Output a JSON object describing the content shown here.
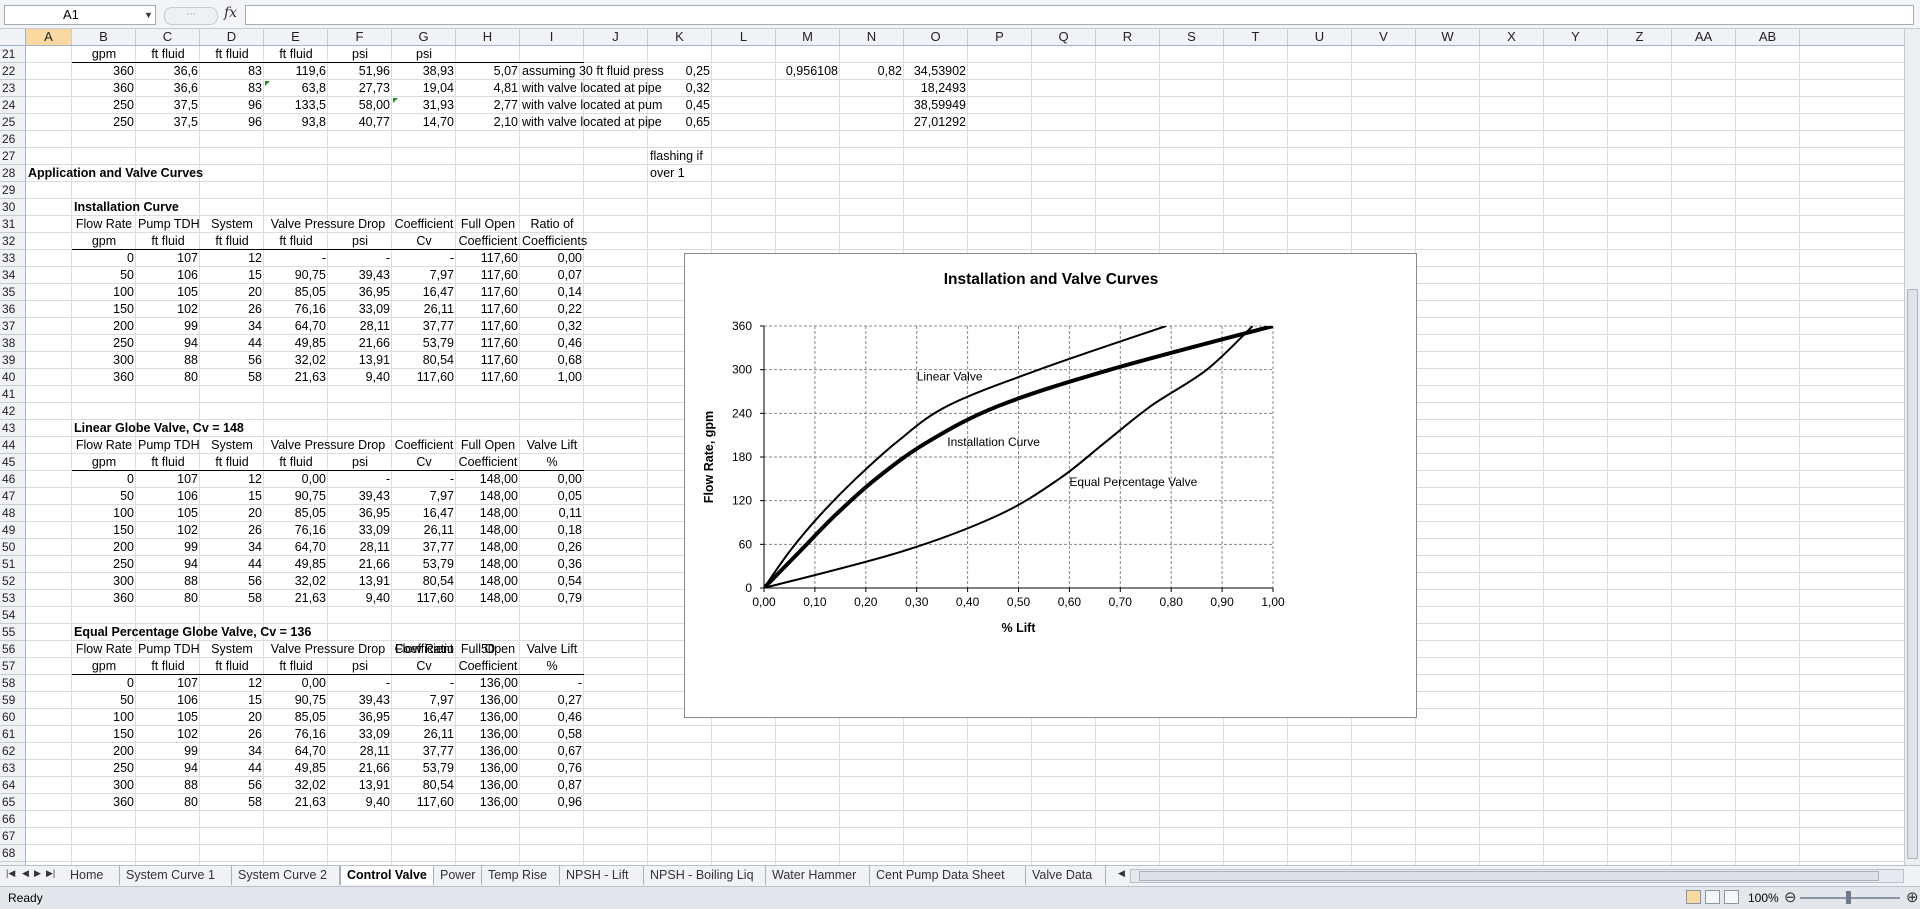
{
  "formula_bar": {
    "name_box": "A1",
    "formula": "",
    "fx": "fx"
  },
  "columns": [
    "A",
    "B",
    "C",
    "D",
    "E",
    "F",
    "G",
    "H",
    "I",
    "J",
    "K",
    "L",
    "M",
    "N",
    "O",
    "P",
    "Q",
    "R",
    "S",
    "T",
    "U",
    "V",
    "W",
    "X",
    "Y",
    "Z",
    "AA",
    "AB"
  ],
  "rows": [
    "21",
    "22",
    "23",
    "24",
    "25",
    "26",
    "27",
    "28",
    "29",
    "30",
    "31",
    "32",
    "33",
    "34",
    "35",
    "36",
    "37",
    "38",
    "39",
    "40",
    "41",
    "42",
    "43",
    "44",
    "45",
    "46",
    "47",
    "48",
    "49",
    "50",
    "51",
    "52",
    "53",
    "54",
    "55",
    "56",
    "57",
    "58",
    "59",
    "60",
    "61",
    "62",
    "63",
    "64",
    "65",
    "66",
    "67",
    "68"
  ],
  "top_block": {
    "units": [
      "gpm",
      "ft fluid",
      "ft fluid",
      "ft fluid",
      "psi",
      "psi"
    ],
    "rows": [
      {
        "b": "360",
        "c": "36,6",
        "d": "83",
        "e": "119,6",
        "f": "51,96",
        "g": "38,93",
        "h": "5,07",
        "i": "assuming 30 ft fluid press",
        "k": "0,25",
        "m": "0,956108",
        "n": "0,82",
        "o": "34,53902"
      },
      {
        "b": "360",
        "c": "36,6",
        "d": "83",
        "e": "63,8",
        "f": "27,73",
        "g": "19,04",
        "h": "4,81",
        "i": "with valve located at pipe",
        "k": "0,32",
        "m": "",
        "n": "",
        "o": "18,2493"
      },
      {
        "b": "250",
        "c": "37,5",
        "d": "96",
        "e": "133,5",
        "f": "58,00",
        "g": "31,93",
        "h": "2,77",
        "i": "with valve located at pum",
        "k": "0,45",
        "m": "",
        "n": "",
        "o": "38,59949"
      },
      {
        "b": "250",
        "c": "37,5",
        "d": "96",
        "e": "93,8",
        "f": "40,77",
        "g": "14,70",
        "h": "2,10",
        "i": "with valve located at pipe",
        "k": "0,65",
        "m": "",
        "n": "",
        "o": "27,01292"
      }
    ],
    "flashing_note": [
      "flashing if",
      "over 1"
    ]
  },
  "section_title": "Application and Valve Curves",
  "tables": [
    {
      "title": "Installation Curve",
      "extra": null,
      "header1": [
        "Flow Rate",
        "Pump TDH",
        "System",
        "Valve Pressure Drop",
        "Coefficient",
        "Full Open",
        "Ratio of"
      ],
      "header2": [
        "gpm",
        "ft fluid",
        "ft fluid",
        "ft fluid",
        "psi",
        "Cv",
        "Coefficient",
        "Coefficients"
      ],
      "rows": [
        [
          "0",
          "107",
          "12",
          "-",
          "-",
          "-",
          "117,60",
          "0,00"
        ],
        [
          "50",
          "106",
          "15",
          "90,75",
          "39,43",
          "7,97",
          "117,60",
          "0,07"
        ],
        [
          "100",
          "105",
          "20",
          "85,05",
          "36,95",
          "16,47",
          "117,60",
          "0,14"
        ],
        [
          "150",
          "102",
          "26",
          "76,16",
          "33,09",
          "26,11",
          "117,60",
          "0,22"
        ],
        [
          "200",
          "99",
          "34",
          "64,70",
          "28,11",
          "37,77",
          "117,60",
          "0,32"
        ],
        [
          "250",
          "94",
          "44",
          "49,85",
          "21,66",
          "53,79",
          "117,60",
          "0,46"
        ],
        [
          "300",
          "88",
          "56",
          "32,02",
          "13,91",
          "80,54",
          "117,60",
          "0,68"
        ],
        [
          "360",
          "80",
          "58",
          "21,63",
          "9,40",
          "117,60",
          "117,60",
          "1,00"
        ]
      ]
    },
    {
      "title": "Linear Globe Valve, Cv = 148",
      "extra": null,
      "header1": [
        "Flow Rate",
        "Pump TDH",
        "System",
        "Valve Pressure Drop",
        "Coefficient",
        "Full Open",
        "Valve Lift"
      ],
      "header2": [
        "gpm",
        "ft fluid",
        "ft fluid",
        "ft fluid",
        "psi",
        "Cv",
        "Coefficient",
        "%"
      ],
      "rows": [
        [
          "0",
          "107",
          "12",
          "0,00",
          "-",
          "-",
          "148,00",
          "0,00"
        ],
        [
          "50",
          "106",
          "15",
          "90,75",
          "39,43",
          "7,97",
          "148,00",
          "0,05"
        ],
        [
          "100",
          "105",
          "20",
          "85,05",
          "36,95",
          "16,47",
          "148,00",
          "0,11"
        ],
        [
          "150",
          "102",
          "26",
          "76,16",
          "33,09",
          "26,11",
          "148,00",
          "0,18"
        ],
        [
          "200",
          "99",
          "34",
          "64,70",
          "28,11",
          "37,77",
          "148,00",
          "0,26"
        ],
        [
          "250",
          "94",
          "44",
          "49,85",
          "21,66",
          "53,79",
          "148,00",
          "0,36"
        ],
        [
          "300",
          "88",
          "56",
          "32,02",
          "13,91",
          "80,54",
          "148,00",
          "0,54"
        ],
        [
          "360",
          "80",
          "58",
          "21,63",
          "9,40",
          "117,60",
          "148,00",
          "0,79"
        ]
      ]
    },
    {
      "title": "Equal Percentage Globe Valve, Cv = 136",
      "extra": {
        "label": "Flow Ratio",
        "value": "50"
      },
      "header1": [
        "Flow Rate",
        "Pump TDH",
        "System",
        "Valve Pressure Drop",
        "Coefficient",
        "Full Open",
        "Valve Lift"
      ],
      "header2": [
        "gpm",
        "ft fluid",
        "ft fluid",
        "ft fluid",
        "psi",
        "Cv",
        "Coefficient",
        "%"
      ],
      "rows": [
        [
          "0",
          "107",
          "12",
          "0,00",
          "-",
          "-",
          "136,00",
          "-"
        ],
        [
          "50",
          "106",
          "15",
          "90,75",
          "39,43",
          "7,97",
          "136,00",
          "0,27"
        ],
        [
          "100",
          "105",
          "20",
          "85,05",
          "36,95",
          "16,47",
          "136,00",
          "0,46"
        ],
        [
          "150",
          "102",
          "26",
          "76,16",
          "33,09",
          "26,11",
          "136,00",
          "0,58"
        ],
        [
          "200",
          "99",
          "34",
          "64,70",
          "28,11",
          "37,77",
          "136,00",
          "0,67"
        ],
        [
          "250",
          "94",
          "44",
          "49,85",
          "21,66",
          "53,79",
          "136,00",
          "0,76"
        ],
        [
          "300",
          "88",
          "56",
          "32,02",
          "13,91",
          "80,54",
          "136,00",
          "0,87"
        ],
        [
          "360",
          "80",
          "58",
          "21,63",
          "9,40",
          "117,60",
          "136,00",
          "0,96"
        ]
      ]
    }
  ],
  "chart_data": {
    "type": "line",
    "title": "Installation and Valve Curves",
    "xlabel": "% Lift",
    "ylabel": "Flow Rate, gpm",
    "xlim": [
      0,
      1
    ],
    "ylim": [
      0,
      360
    ],
    "xticks": [
      "0,00",
      "0,10",
      "0,20",
      "0,30",
      "0,40",
      "0,50",
      "0,60",
      "0,70",
      "0,80",
      "0,90",
      "1,00"
    ],
    "yticks": [
      "0",
      "60",
      "120",
      "180",
      "240",
      "300",
      "360"
    ],
    "grid": true,
    "series": [
      {
        "name": "Linear Valve",
        "width": 2,
        "x": [
          0,
          0.05,
          0.11,
          0.18,
          0.26,
          0.36,
          0.54,
          0.79
        ],
        "y": [
          0,
          50,
          100,
          150,
          200,
          250,
          300,
          360
        ]
      },
      {
        "name": "Installation Curve",
        "width": 4,
        "x": [
          0,
          0.07,
          0.14,
          0.22,
          0.32,
          0.46,
          0.68,
          1.0
        ],
        "y": [
          0,
          50,
          100,
          150,
          200,
          250,
          300,
          360
        ]
      },
      {
        "name": "Equal Percentage Valve",
        "width": 2,
        "x": [
          0,
          0.27,
          0.46,
          0.58,
          0.67,
          0.76,
          0.87,
          0.96
        ],
        "y": [
          0,
          50,
          100,
          150,
          200,
          250,
          300,
          360
        ]
      }
    ]
  },
  "sheet_tabs": [
    "Home",
    "System Curve 1",
    "System Curve 2",
    "Control Valve",
    "Power",
    "Temp Rise",
    "NPSH - Lift",
    "NPSH - Boiling Liq",
    "Water Hammer",
    "Cent Pump Data Sheet",
    "Valve Data"
  ],
  "active_tab": "Control Valve",
  "status": {
    "text": "Ready",
    "zoom": "100%"
  }
}
